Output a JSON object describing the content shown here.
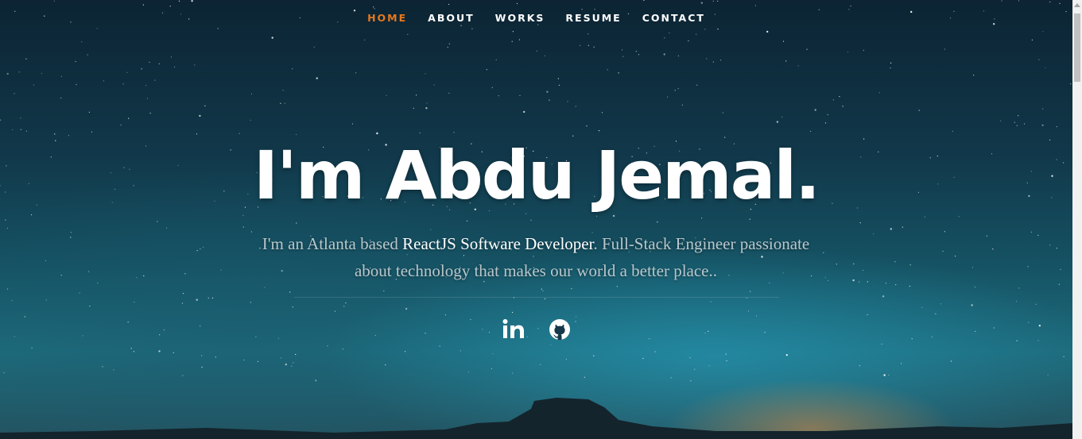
{
  "nav": {
    "items": [
      {
        "label": "HOME",
        "active": true
      },
      {
        "label": "ABOUT",
        "active": false
      },
      {
        "label": "WORKS",
        "active": false
      },
      {
        "label": "RESUME",
        "active": false
      },
      {
        "label": "CONTACT",
        "active": false
      }
    ],
    "active_color": "#e6781e"
  },
  "hero": {
    "title": "I'm Abdu Jemal.",
    "intro": {
      "prefix": "I'm an Atlanta based ",
      "highlight": "ReactJS Software Developer",
      "suffix": ". Full-Stack Engineer passionate about technology that makes our world a better place.."
    }
  },
  "social": [
    {
      "name": "linkedin",
      "icon": "linkedin-icon"
    },
    {
      "name": "github",
      "icon": "github-icon"
    }
  ],
  "colors": {
    "accent": "#e6781e",
    "text": "#ffffff",
    "muted_text": "#b9c7cc"
  }
}
